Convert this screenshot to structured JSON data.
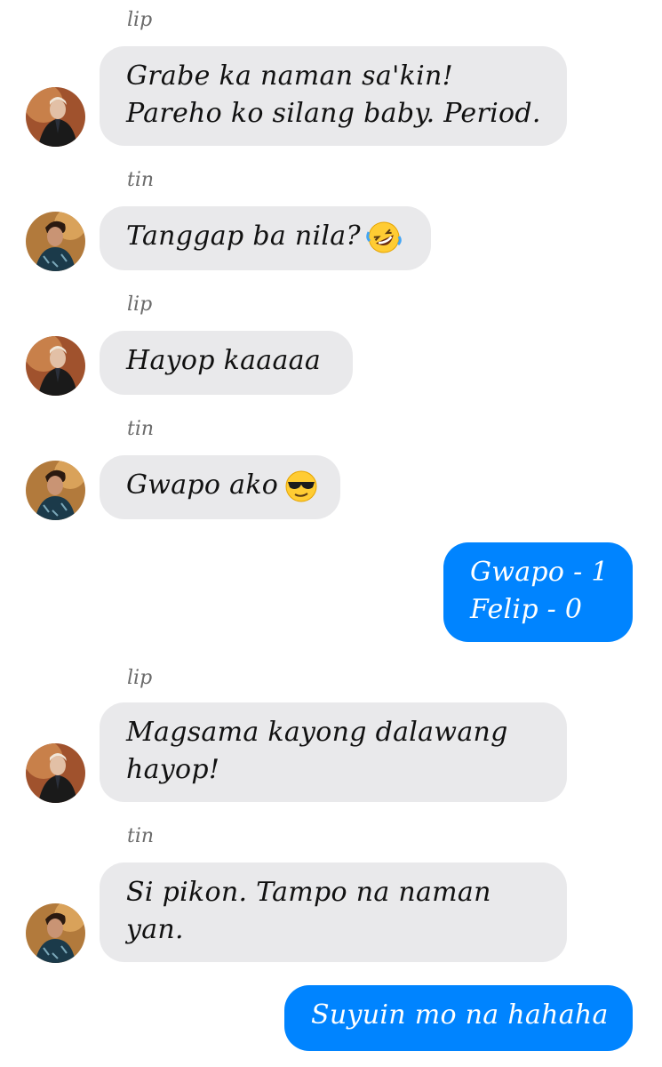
{
  "messages": [
    {
      "sender": "lip",
      "lines": [
        "Grabe ka naman sa'kin!",
        "Pareho ko silang baby. Period."
      ]
    },
    {
      "sender": "tin",
      "lines": [
        "Tanggap ba nila?"
      ],
      "emoji": "rolling-on-floor-laughing-emoji"
    },
    {
      "sender": "lip",
      "lines": [
        "Hayop kaaaaa"
      ]
    },
    {
      "sender": "tin",
      "lines": [
        "Gwapo ako"
      ],
      "emoji": "sunglasses-face-emoji"
    },
    {
      "sender": "me",
      "lines": [
        "Gwapo - 1",
        "Felip - 0"
      ]
    },
    {
      "sender": "lip",
      "lines": [
        "Magsama kayong dalawang",
        "hayop!"
      ]
    },
    {
      "sender": "tin",
      "lines": [
        "Si pikon. Tampo na naman",
        "yan."
      ]
    },
    {
      "sender": "me",
      "lines": [
        "Suyuin mo na hahaha"
      ]
    }
  ],
  "colors": {
    "incoming_bubble": "#e9e9eb",
    "outgoing_bubble": "#0084ff",
    "sender_label": "#6b6b6b"
  }
}
